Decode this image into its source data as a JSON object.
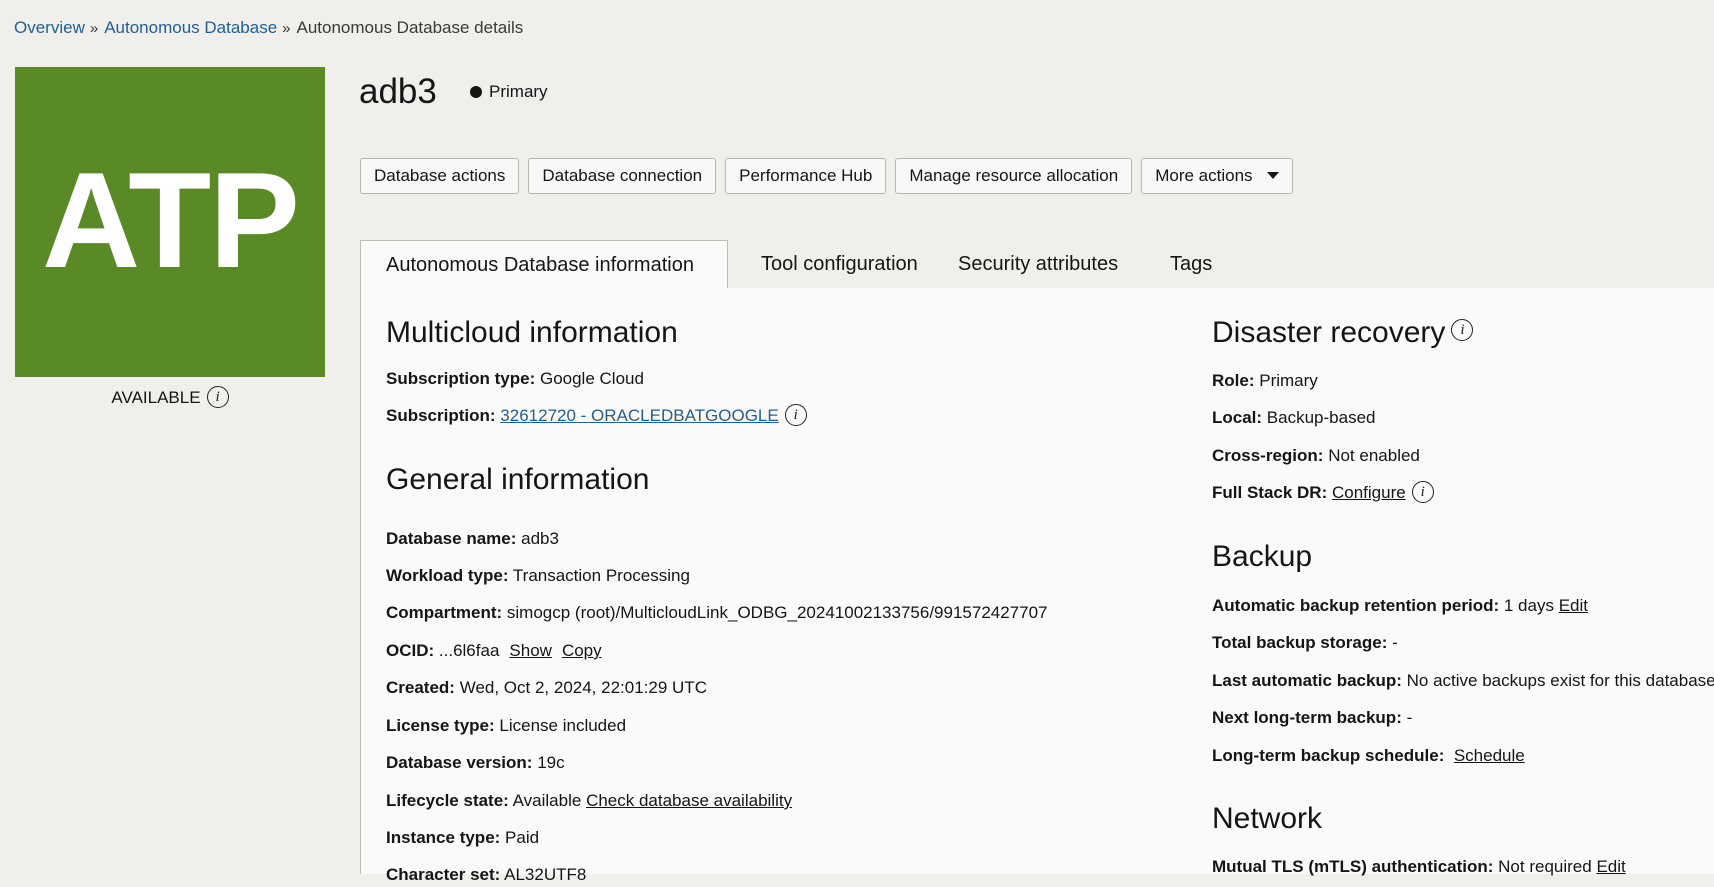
{
  "breadcrumb": {
    "items": [
      "Overview",
      "Autonomous Database",
      "Autonomous Database details"
    ],
    "separator": "»"
  },
  "logo": {
    "text": "ATP",
    "color": "#5a8a26"
  },
  "status": {
    "label": "AVAILABLE"
  },
  "header": {
    "title": "adb3",
    "role": "Primary"
  },
  "actions": {
    "database_actions": "Database actions",
    "database_connection": "Database connection",
    "performance_hub": "Performance Hub",
    "manage_resource": "Manage resource allocation",
    "more_actions": "More actions"
  },
  "tabs": [
    {
      "label": "Autonomous Database information",
      "active": true
    },
    {
      "label": "Tool configuration",
      "active": false
    },
    {
      "label": "Security attributes",
      "active": false
    },
    {
      "label": "Tags",
      "active": false
    }
  ],
  "multicloud": {
    "title": "Multicloud information",
    "subscription_type_label": "Subscription type:",
    "subscription_type_value": "Google Cloud",
    "subscription_label": "Subscription:",
    "subscription_value": "32612720 - ORACLEDBATGOOGLE"
  },
  "general": {
    "title": "General information",
    "db_name_label": "Database name:",
    "db_name_value": "adb3",
    "workload_label": "Workload type:",
    "workload_value": "Transaction Processing",
    "compartment_label": "Compartment:",
    "compartment_value": "simogcp (root)/MulticloudLink_ODBG_20241002133756/991572427707",
    "ocid_label": "OCID:",
    "ocid_value": "...6l6faa",
    "ocid_show": "Show",
    "ocid_copy": "Copy",
    "created_label": "Created:",
    "created_value": "Wed, Oct 2, 2024, 22:01:29 UTC",
    "license_label": "License type:",
    "license_value": "License included",
    "version_label": "Database version:",
    "version_value": "19c",
    "lifecycle_label": "Lifecycle state:",
    "lifecycle_value": "Available",
    "lifecycle_link": "Check database availability",
    "instance_label": "Instance type:",
    "instance_value": "Paid",
    "charset_label": "Character set:",
    "charset_value": "AL32UTF8"
  },
  "disaster_recovery": {
    "title": "Disaster recovery",
    "role_label": "Role:",
    "role_value": "Primary",
    "local_label": "Local:",
    "local_value": "Backup-based",
    "cross_region_label": "Cross-region:",
    "cross_region_value": "Not enabled",
    "full_stack_label": "Full Stack DR:",
    "full_stack_link": "Configure"
  },
  "backup": {
    "title": "Backup",
    "retention_label": "Automatic backup retention period:",
    "retention_value": "1 days",
    "retention_edit": "Edit",
    "storage_label": "Total backup storage:",
    "storage_value": "-",
    "last_label": "Last automatic backup:",
    "last_value": "No active backups exist for this database",
    "next_label": "Next long-term backup:",
    "next_value": "-",
    "schedule_label": "Long-term backup schedule:",
    "schedule_link": "Schedule"
  },
  "network": {
    "title": "Network",
    "mtls_label": "Mutual TLS (mTLS) authentication:",
    "mtls_value": "Not required",
    "mtls_edit": "Edit"
  }
}
